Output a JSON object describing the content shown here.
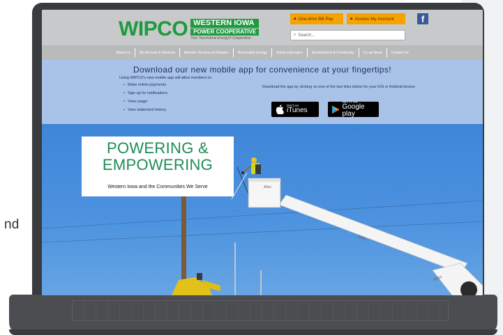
{
  "page_fragment": "nd",
  "site": {
    "logo_main": "WIPCO",
    "logo_line1": "WESTERN IOWA",
    "logo_line2": "POWER COOPERATIVE",
    "logo_tagline": "Your Touchstone Energy® Cooperative",
    "bill_pay_label": "One-time Bill Pay",
    "account_label": "Access My Account",
    "search_placeholder": "Search...",
    "nav": [
      "About Us",
      "My Account & Services",
      "Member Services & Rebates",
      "Renewable Energy",
      "Safety Education",
      "Development & Community",
      "Co-op News",
      "Contact Us"
    ]
  },
  "banner": {
    "title": "Download our new mobile app for convenience at your fingertips!",
    "subtitle": "Using WIPCO's new mobile app will allow members to:",
    "features": [
      "Make online payments",
      "Sign up for notifications",
      "View usage",
      "View statement history"
    ],
    "download_text": "Download the app by clicking on one of the two links below for your iOS or Android device:",
    "itunes_small": "Get it on",
    "itunes_big": "iTunes",
    "gplay_small": "GET IT ON",
    "gplay_big": "Google play"
  },
  "hero": {
    "title_line1": "POWERING &",
    "title_line2": "EMPOWERING",
    "subtitle": "Western Iowa and the Communities We Serve",
    "truck_text": "Altec"
  },
  "colors": {
    "accent_green": "#1d9a3e",
    "button_orange": "#f6a300",
    "banner_blue": "#a9c3e8",
    "sky_blue": "#4c92df",
    "facebook_blue": "#3b5998"
  }
}
